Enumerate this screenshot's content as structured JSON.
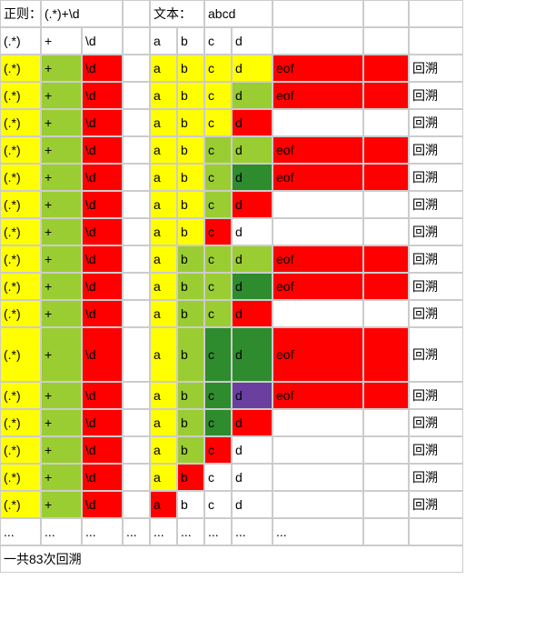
{
  "labels": {
    "regex_label": "正则：",
    "regex_value": "(.*)+\\d",
    "text_label": "文本：",
    "text_value": "abcd",
    "backtrack": "回溯",
    "footer": "一共83次回溯",
    "ellipsis": "..."
  },
  "header1": {
    "c0": "(.*)",
    "c1": "+",
    "c2": "\\d",
    "c4": "a",
    "c5": "b",
    "c6": "c",
    "c7": "d"
  },
  "patterns": {
    "group": "(.*)",
    "plus": "+",
    "digit": "\\d"
  },
  "chars": {
    "a": "a",
    "b": "b",
    "c": "c",
    "d": "d",
    "eof": "eof"
  },
  "rows": [
    {
      "c0": {
        "v": "(.*)",
        "cls": "yellow"
      },
      "c1": {
        "v": "+",
        "cls": "lightgreen"
      },
      "c2": {
        "v": "\\d",
        "cls": "red"
      },
      "c4": {
        "v": "a",
        "cls": "yellow"
      },
      "c5": {
        "v": "b",
        "cls": "yellow"
      },
      "c6": {
        "v": "c",
        "cls": "yellow"
      },
      "c7": {
        "v": "d",
        "cls": "yellow"
      },
      "c8": {
        "v": "eof",
        "cls": "red"
      },
      "c9": {
        "v": "",
        "cls": "red"
      },
      "c10": {
        "v": "回溯",
        "cls": "white"
      }
    },
    {
      "c0": {
        "v": "(.*)",
        "cls": "yellow"
      },
      "c1": {
        "v": "+",
        "cls": "lightgreen"
      },
      "c2": {
        "v": "\\d",
        "cls": "red"
      },
      "c4": {
        "v": "a",
        "cls": "yellow"
      },
      "c5": {
        "v": "b",
        "cls": "yellow"
      },
      "c6": {
        "v": "c",
        "cls": "yellow"
      },
      "c7": {
        "v": "d",
        "cls": "lightgreen"
      },
      "c8": {
        "v": "eof",
        "cls": "red"
      },
      "c9": {
        "v": "",
        "cls": "red"
      },
      "c10": {
        "v": "回溯",
        "cls": "white"
      }
    },
    {
      "c0": {
        "v": "(.*)",
        "cls": "yellow"
      },
      "c1": {
        "v": "+",
        "cls": "lightgreen"
      },
      "c2": {
        "v": "\\d",
        "cls": "red"
      },
      "c4": {
        "v": "a",
        "cls": "yellow"
      },
      "c5": {
        "v": "b",
        "cls": "yellow"
      },
      "c6": {
        "v": "c",
        "cls": "yellow"
      },
      "c7": {
        "v": "d",
        "cls": "red"
      },
      "c8": {
        "v": "",
        "cls": "white"
      },
      "c9": {
        "v": "",
        "cls": "white"
      },
      "c10": {
        "v": "回溯",
        "cls": "white"
      }
    },
    {
      "c0": {
        "v": "(.*)",
        "cls": "yellow"
      },
      "c1": {
        "v": "+",
        "cls": "lightgreen"
      },
      "c2": {
        "v": "\\d",
        "cls": "red"
      },
      "c4": {
        "v": "a",
        "cls": "yellow"
      },
      "c5": {
        "v": "b",
        "cls": "yellow"
      },
      "c6": {
        "v": "c",
        "cls": "lightgreen"
      },
      "c7": {
        "v": "d",
        "cls": "lightgreen"
      },
      "c8": {
        "v": "eof",
        "cls": "red"
      },
      "c9": {
        "v": "",
        "cls": "red"
      },
      "c10": {
        "v": "回溯",
        "cls": "white"
      }
    },
    {
      "c0": {
        "v": "(.*)",
        "cls": "yellow"
      },
      "c1": {
        "v": "+",
        "cls": "lightgreen"
      },
      "c2": {
        "v": "\\d",
        "cls": "red"
      },
      "c4": {
        "v": "a",
        "cls": "yellow"
      },
      "c5": {
        "v": "b",
        "cls": "yellow"
      },
      "c6": {
        "v": "c",
        "cls": "lightgreen"
      },
      "c7": {
        "v": "d",
        "cls": "green"
      },
      "c8": {
        "v": "eof",
        "cls": "red"
      },
      "c9": {
        "v": "",
        "cls": "red"
      },
      "c10": {
        "v": "回溯",
        "cls": "white"
      }
    },
    {
      "c0": {
        "v": "(.*)",
        "cls": "yellow"
      },
      "c1": {
        "v": "+",
        "cls": "lightgreen"
      },
      "c2": {
        "v": "\\d",
        "cls": "red"
      },
      "c4": {
        "v": "a",
        "cls": "yellow"
      },
      "c5": {
        "v": "b",
        "cls": "yellow"
      },
      "c6": {
        "v": "c",
        "cls": "lightgreen"
      },
      "c7": {
        "v": "d",
        "cls": "red"
      },
      "c8": {
        "v": "",
        "cls": "white"
      },
      "c9": {
        "v": "",
        "cls": "white"
      },
      "c10": {
        "v": "回溯",
        "cls": "white"
      }
    },
    {
      "c0": {
        "v": "(.*)",
        "cls": "yellow"
      },
      "c1": {
        "v": "+",
        "cls": "lightgreen"
      },
      "c2": {
        "v": "\\d",
        "cls": "red"
      },
      "c4": {
        "v": "a",
        "cls": "yellow"
      },
      "c5": {
        "v": "b",
        "cls": "yellow"
      },
      "c6": {
        "v": "c",
        "cls": "red"
      },
      "c7": {
        "v": "d",
        "cls": "white"
      },
      "c8": {
        "v": "",
        "cls": "white"
      },
      "c9": {
        "v": "",
        "cls": "white"
      },
      "c10": {
        "v": "回溯",
        "cls": "white"
      }
    },
    {
      "c0": {
        "v": "(.*)",
        "cls": "yellow"
      },
      "c1": {
        "v": "+",
        "cls": "lightgreen"
      },
      "c2": {
        "v": "\\d",
        "cls": "red"
      },
      "c4": {
        "v": "a",
        "cls": "yellow"
      },
      "c5": {
        "v": "b",
        "cls": "lightgreen"
      },
      "c6": {
        "v": "c",
        "cls": "lightgreen"
      },
      "c7": {
        "v": "d",
        "cls": "lightgreen"
      },
      "c8": {
        "v": "eof",
        "cls": "red"
      },
      "c9": {
        "v": "",
        "cls": "red"
      },
      "c10": {
        "v": "回溯",
        "cls": "white"
      }
    },
    {
      "c0": {
        "v": "(.*)",
        "cls": "yellow"
      },
      "c1": {
        "v": "+",
        "cls": "lightgreen"
      },
      "c2": {
        "v": "\\d",
        "cls": "red"
      },
      "c4": {
        "v": "a",
        "cls": "yellow"
      },
      "c5": {
        "v": "b",
        "cls": "lightgreen"
      },
      "c6": {
        "v": "c",
        "cls": "lightgreen"
      },
      "c7": {
        "v": "d",
        "cls": "green"
      },
      "c8": {
        "v": "eof",
        "cls": "red"
      },
      "c9": {
        "v": "",
        "cls": "red"
      },
      "c10": {
        "v": "回溯",
        "cls": "white"
      }
    },
    {
      "c0": {
        "v": "(.*)",
        "cls": "yellow"
      },
      "c1": {
        "v": "+",
        "cls": "lightgreen"
      },
      "c2": {
        "v": "\\d",
        "cls": "red"
      },
      "c4": {
        "v": "a",
        "cls": "yellow"
      },
      "c5": {
        "v": "b",
        "cls": "lightgreen"
      },
      "c6": {
        "v": "c",
        "cls": "lightgreen"
      },
      "c7": {
        "v": "d",
        "cls": "red"
      },
      "c8": {
        "v": "",
        "cls": "white"
      },
      "c9": {
        "v": "",
        "cls": "white"
      },
      "c10": {
        "v": "回溯",
        "cls": "white"
      }
    },
    {
      "tall": true,
      "c0": {
        "v": "(.*)",
        "cls": "yellow"
      },
      "c1": {
        "v": "+",
        "cls": "lightgreen"
      },
      "c2": {
        "v": "\\d",
        "cls": "red"
      },
      "c4": {
        "v": "a",
        "cls": "yellow"
      },
      "c5": {
        "v": "b",
        "cls": "lightgreen"
      },
      "c6": {
        "v": "c",
        "cls": "green"
      },
      "c7": {
        "v": "d",
        "cls": "green"
      },
      "c8": {
        "v": "eof",
        "cls": "red"
      },
      "c9": {
        "v": "",
        "cls": "red"
      },
      "c10": {
        "v": "回溯",
        "cls": "white"
      }
    },
    {
      "c0": {
        "v": "(.*)",
        "cls": "yellow"
      },
      "c1": {
        "v": "+",
        "cls": "lightgreen"
      },
      "c2": {
        "v": "\\d",
        "cls": "red"
      },
      "c4": {
        "v": "a",
        "cls": "yellow"
      },
      "c5": {
        "v": "b",
        "cls": "lightgreen"
      },
      "c6": {
        "v": "c",
        "cls": "green"
      },
      "c7": {
        "v": "d",
        "cls": "purple"
      },
      "c8": {
        "v": "eof",
        "cls": "red"
      },
      "c9": {
        "v": "",
        "cls": "red"
      },
      "c10": {
        "v": "回溯",
        "cls": "white"
      }
    },
    {
      "c0": {
        "v": "(.*)",
        "cls": "yellow"
      },
      "c1": {
        "v": "+",
        "cls": "lightgreen"
      },
      "c2": {
        "v": "\\d",
        "cls": "red"
      },
      "c4": {
        "v": "a",
        "cls": "yellow"
      },
      "c5": {
        "v": "b",
        "cls": "lightgreen"
      },
      "c6": {
        "v": "c",
        "cls": "green"
      },
      "c7": {
        "v": "d",
        "cls": "red"
      },
      "c8": {
        "v": "",
        "cls": "white"
      },
      "c9": {
        "v": "",
        "cls": "white"
      },
      "c10": {
        "v": "回溯",
        "cls": "white"
      }
    },
    {
      "c0": {
        "v": "(.*)",
        "cls": "yellow"
      },
      "c1": {
        "v": "+",
        "cls": "lightgreen"
      },
      "c2": {
        "v": "\\d",
        "cls": "red"
      },
      "c4": {
        "v": "a",
        "cls": "yellow"
      },
      "c5": {
        "v": "b",
        "cls": "lightgreen"
      },
      "c6": {
        "v": "c",
        "cls": "red"
      },
      "c7": {
        "v": "d",
        "cls": "white"
      },
      "c8": {
        "v": "",
        "cls": "white"
      },
      "c9": {
        "v": "",
        "cls": "white"
      },
      "c10": {
        "v": "回溯",
        "cls": "white"
      }
    },
    {
      "c0": {
        "v": "(.*)",
        "cls": "yellow"
      },
      "c1": {
        "v": "+",
        "cls": "lightgreen"
      },
      "c2": {
        "v": "\\d",
        "cls": "red"
      },
      "c4": {
        "v": "a",
        "cls": "yellow"
      },
      "c5": {
        "v": "b",
        "cls": "red"
      },
      "c6": {
        "v": "c",
        "cls": "white"
      },
      "c7": {
        "v": "d",
        "cls": "white"
      },
      "c8": {
        "v": "",
        "cls": "white"
      },
      "c9": {
        "v": "",
        "cls": "white"
      },
      "c10": {
        "v": "回溯",
        "cls": "white"
      }
    },
    {
      "c0": {
        "v": "(.*)",
        "cls": "yellow"
      },
      "c1": {
        "v": "+",
        "cls": "lightgreen"
      },
      "c2": {
        "v": "\\d",
        "cls": "red"
      },
      "c4": {
        "v": "a",
        "cls": "red"
      },
      "c5": {
        "v": "b",
        "cls": "white"
      },
      "c6": {
        "v": "c",
        "cls": "white"
      },
      "c7": {
        "v": "d",
        "cls": "white"
      },
      "c8": {
        "v": "",
        "cls": "white"
      },
      "c9": {
        "v": "",
        "cls": "white"
      },
      "c10": {
        "v": "回溯",
        "cls": "white"
      }
    }
  ]
}
